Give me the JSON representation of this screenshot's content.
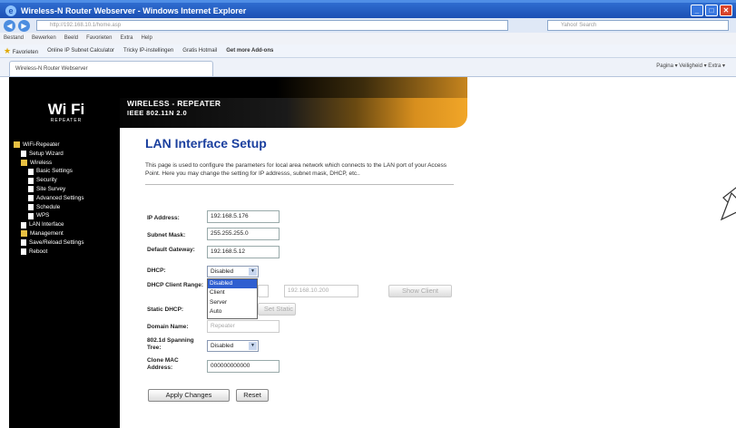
{
  "window": {
    "title": "Wireless-N Router Webserver - Windows Internet Explorer",
    "address": "http://192.168.10.1/home.asp",
    "search_placeholder": "Yahoo! Search",
    "menu": [
      "Bestand",
      "Bewerken",
      "Beeld",
      "Favorieten",
      "Extra",
      "Help"
    ],
    "favorites": {
      "label": "Favorieten",
      "items": [
        "Online IP Subnet Calculator",
        "Tricky IP-instellingen",
        "Gratis Hotmail",
        "Get more Add-ons"
      ]
    },
    "tab_title": "Wireless-N Router Webserver",
    "tools": "Pagina ▾  Veiligheid ▾  Extra ▾"
  },
  "banner": {
    "line1": "WIRELESS - REPEATER",
    "line2": "IEEE 802.11N 2.0"
  },
  "logo": {
    "main": "Wi Fi",
    "sub": "REPEATER"
  },
  "tree": [
    {
      "label": "WiFi-Repeater",
      "level": 0,
      "icon": "folder"
    },
    {
      "label": "Setup Wizard",
      "level": 1,
      "icon": "doc"
    },
    {
      "label": "Wireless",
      "level": 1,
      "icon": "folder"
    },
    {
      "label": "Basic Settings",
      "level": 2,
      "icon": "doc"
    },
    {
      "label": "Security",
      "level": 2,
      "icon": "doc"
    },
    {
      "label": "Site Survey",
      "level": 2,
      "icon": "doc"
    },
    {
      "label": "Advanced Settings",
      "level": 2,
      "icon": "doc"
    },
    {
      "label": "Schedule",
      "level": 2,
      "icon": "doc"
    },
    {
      "label": "WPS",
      "level": 2,
      "icon": "doc"
    },
    {
      "label": "LAN Interface",
      "level": 1,
      "icon": "doc"
    },
    {
      "label": "Management",
      "level": 1,
      "icon": "folder"
    },
    {
      "label": "Save/Reload Settings",
      "level": 1,
      "icon": "doc"
    },
    {
      "label": "Reboot",
      "level": 1,
      "icon": "doc"
    }
  ],
  "content": {
    "title": "LAN Interface Setup",
    "description": "This page is used to configure the parameters for local area network which connects to the LAN port of your Access Point. Here you may change the setting for IP addresss, subnet mask, DHCP, etc..",
    "fields": {
      "ip_label": "IP Address:",
      "ip_value": "192.168.5.176",
      "mask_label": "Subnet Mask:",
      "mask_value": "255.255.255.0",
      "gw_label": "Default Gateway:",
      "gw_value": "192.168.5.12",
      "dhcp_label": "DHCP:",
      "dhcp_value": "Disabled",
      "range_label": "DHCP Client Range:",
      "range_end": "192.168.10.200",
      "static_label": "Static DHCP:",
      "static_btn": "Set Static DHCP",
      "domain_label": "Domain Name:",
      "domain_value": "Repeater",
      "stp_label": "802.1d Spanning Tree:",
      "stp_value": "Disabled",
      "mac_label": "Clone MAC Address:",
      "mac_value": "000000000000"
    },
    "dhcp_options": [
      "Disabled",
      "Client",
      "Server",
      "Auto"
    ],
    "show_client": "Show Client",
    "apply": "Apply Changes",
    "reset": "Reset"
  }
}
